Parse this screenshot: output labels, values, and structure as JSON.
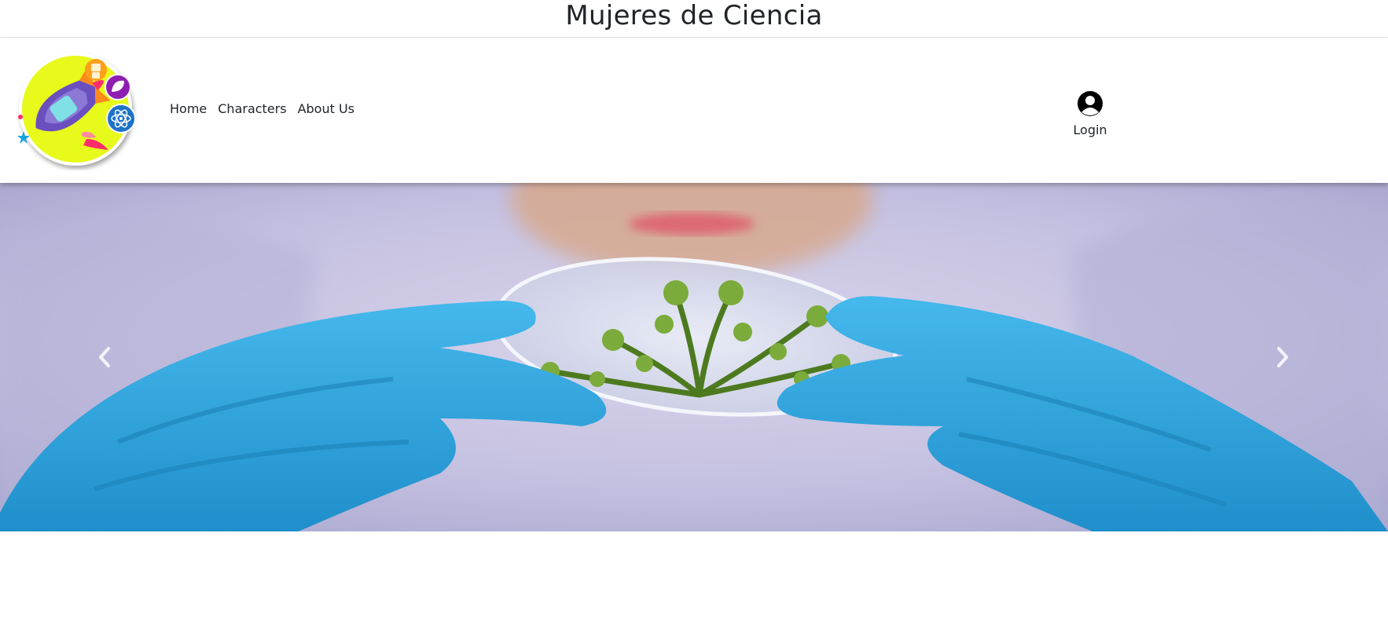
{
  "site": {
    "title": "Mujeres de Ciencia"
  },
  "nav": {
    "logo_icon": "rocket-science-logo",
    "links": [
      {
        "label": "Home"
      },
      {
        "label": "Characters"
      },
      {
        "label": "About Us"
      }
    ],
    "login": {
      "label": "Login",
      "icon": "user-circle-icon"
    }
  },
  "carousel": {
    "image_subject": "gloved hands holding petri dish with green plant",
    "prev_icon": "chevron-left-icon",
    "next_icon": "chevron-right-icon",
    "colors": {
      "glove": "#2fa8e0",
      "background": "#c9c6e4",
      "plant": "#5e8f2a"
    }
  }
}
